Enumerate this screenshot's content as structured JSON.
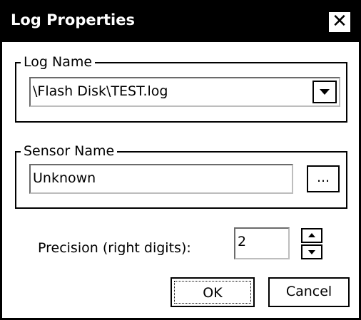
{
  "window": {
    "title": "Log Properties",
    "close_glyph": "✕",
    "close_icon": "close-icon"
  },
  "log_name": {
    "group_label": "Log Name",
    "value": "\\Flash Disk\\TEST.log",
    "dropdown_icon": "chevron-down-icon"
  },
  "sensor_name": {
    "group_label": "Sensor Name",
    "value": "Unknown",
    "browse_label": "..."
  },
  "precision": {
    "label": "Precision (right digits):",
    "value": "2",
    "spin_up_icon": "arrow-up-icon",
    "spin_down_icon": "arrow-down-icon"
  },
  "buttons": {
    "ok_label": "OK",
    "cancel_label": "Cancel"
  },
  "colors": {
    "titlebar_bg": "#000000",
    "titlebar_text": "#ffffff",
    "background": "#ffffff"
  }
}
